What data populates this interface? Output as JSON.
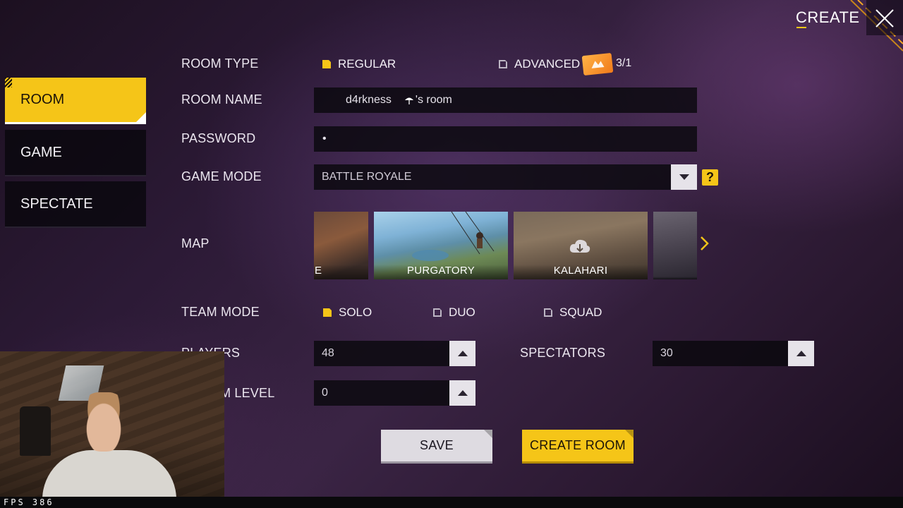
{
  "header": {
    "title": "CREATE",
    "close_icon": "close-icon"
  },
  "sidebar": {
    "tabs": [
      {
        "label": "ROOM",
        "active": true
      },
      {
        "label": "GAME",
        "active": false
      },
      {
        "label": "SPECTATE",
        "active": false
      }
    ]
  },
  "form": {
    "room_type": {
      "label": "ROOM TYPE",
      "options": [
        {
          "label": "REGULAR",
          "selected": true
        },
        {
          "label": "ADVANCED",
          "selected": false
        }
      ],
      "ticket_count": "3/1",
      "ticket_icon": "room-card-icon"
    },
    "room_name": {
      "label": "ROOM NAME",
      "owner": "d4rkness",
      "suffix": "'s room",
      "owner_icon": "umbrella-icon"
    },
    "password": {
      "label": "PASSWORD",
      "value": "•"
    },
    "game_mode": {
      "label": "GAME MODE",
      "value": "BATTLE ROYALE",
      "help": "?"
    },
    "map": {
      "label": "MAP",
      "tiles": [
        {
          "name": "E",
          "selected": false
        },
        {
          "name": "PURGATORY",
          "selected": true
        },
        {
          "name": "KALAHARI",
          "selected": false,
          "icon": "cloud-download-icon"
        },
        {
          "name": "",
          "selected": false
        }
      ],
      "next_icon": "chevron-right-icon"
    },
    "team_mode": {
      "label": "TEAM MODE",
      "options": [
        {
          "label": "SOLO",
          "selected": true
        },
        {
          "label": "DUO",
          "selected": false
        },
        {
          "label": "SQUAD",
          "selected": false
        }
      ]
    },
    "players": {
      "label": "PLAYERS",
      "value": "48"
    },
    "spectators": {
      "label": "SPECTATORS",
      "value": "30"
    },
    "minimum_level": {
      "label": "M LEVEL",
      "value": "0"
    }
  },
  "actions": {
    "save": "SAVE",
    "create_room": "CREATE ROOM"
  },
  "overlay": {
    "fps": "FPS 386"
  },
  "colors": {
    "accent": "#f5c518",
    "panel": "#0a080e",
    "button_light": "#dedbe1"
  }
}
